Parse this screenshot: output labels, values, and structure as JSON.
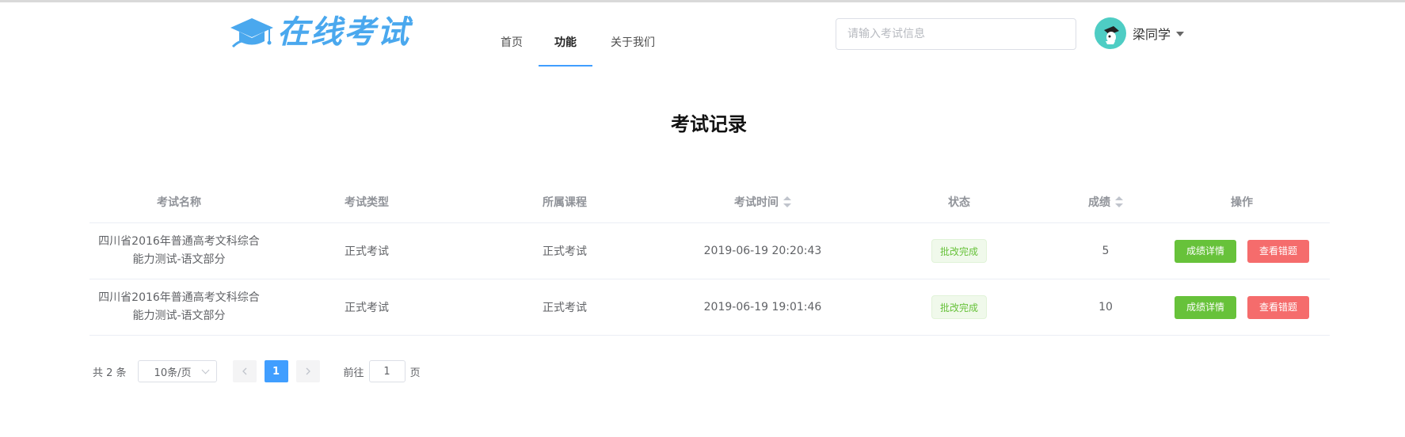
{
  "header": {
    "logo_text": "在线考试",
    "nav": [
      {
        "label": "首页"
      },
      {
        "label": "功能"
      },
      {
        "label": "关于我们"
      }
    ],
    "search_placeholder": "请输入考试信息",
    "user_name": "梁同学",
    "logo_color": "#4aa8ee",
    "active_accent": "#409eff"
  },
  "page_title": "考试记录",
  "table": {
    "headers": [
      "考试名称",
      "考试类型",
      "所属课程",
      "考试时间",
      "状态",
      "成绩",
      "操作"
    ],
    "sortable_columns": [
      "考试时间",
      "成绩"
    ],
    "rows": [
      {
        "name_line1": "四川省2016年普通高考文科综合",
        "name_line2": "能力测试-语文部分",
        "type": "正式考试",
        "course": "正式考试",
        "time": "2019-06-19 20:20:43",
        "status": "批改完成",
        "score": "5",
        "action_detail": "成绩详情",
        "action_wrong": "查看错题"
      },
      {
        "name_line1": "四川省2016年普通高考文科综合",
        "name_line2": "能力测试-语文部分",
        "type": "正式考试",
        "course": "正式考试",
        "time": "2019-06-19 19:01:46",
        "status": "批改完成",
        "score": "10",
        "action_detail": "成绩详情",
        "action_wrong": "查看错题"
      }
    ]
  },
  "pagination": {
    "total": "共 2 条",
    "page_size": "10条/页",
    "prev_icon": "chevron-left-icon",
    "current_page": "1",
    "next_icon": "chevron-right-icon",
    "goto_prefix": "前往",
    "goto_value": "1",
    "goto_suffix": "页"
  },
  "colors": {
    "success": "#67c23a",
    "danger": "#f56c6c",
    "primary": "#409eff"
  }
}
